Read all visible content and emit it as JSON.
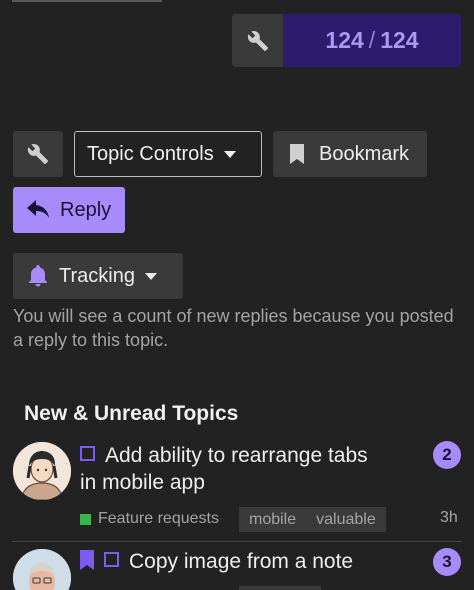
{
  "progress": {
    "current": "124",
    "separator": "/",
    "total": "124"
  },
  "controls": {
    "topic_controls_label": "Topic Controls",
    "bookmark_label": "Bookmark",
    "reply_label": "Reply",
    "tracking_label": "Tracking",
    "tracking_description": "You will see a count of new replies because you posted a reply to this topic."
  },
  "section": {
    "title": "New & Unread Topics"
  },
  "topics": [
    {
      "title": "Add ability to rearrange tabs in mobile app",
      "category": "Feature requests",
      "tags": [
        "mobile",
        "valuable"
      ],
      "age": "3h",
      "unread_count": "2"
    },
    {
      "title": "Copy image from a note",
      "unread_count": "3"
    }
  ],
  "colors": {
    "accent": "#a78bfa",
    "progress_bg": "#2d1b6e",
    "category_color": "#3ab54a",
    "background": "#222222"
  },
  "icons": {
    "wrench": "wrench-icon",
    "bookmark": "bookmark-icon",
    "reply": "reply-arrow-icon",
    "tracking": "bell-icon"
  }
}
